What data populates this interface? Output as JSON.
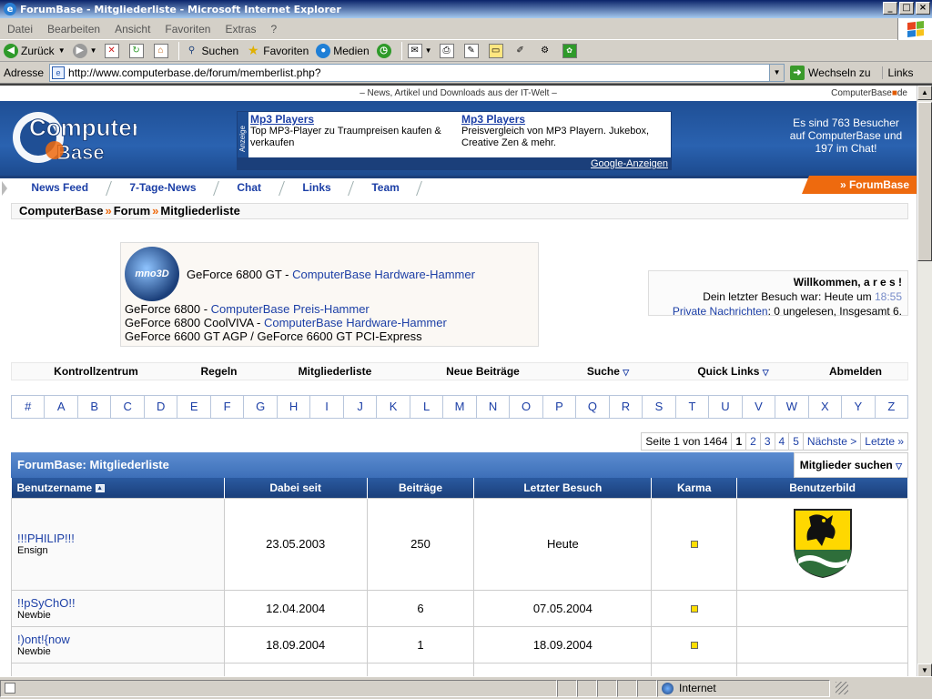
{
  "window": {
    "title": "ForumBase - Mitgliederliste - Microsoft Internet Explorer"
  },
  "menubar": [
    "Datei",
    "Bearbeiten",
    "Ansicht",
    "Favoriten",
    "Extras",
    "?"
  ],
  "toolbar": {
    "back": "Zurück",
    "search": "Suchen",
    "favorites": "Favoriten",
    "media": "Medien"
  },
  "addressbar": {
    "label": "Adresse",
    "url": "http://www.computerbase.de/forum/memberlist.php?",
    "go": "Wechseln zu",
    "links": "Links"
  },
  "site": {
    "tagline": "– News, Artikel und Downloads aus der IT-Welt –",
    "domain_left": "ComputerBase",
    "domain_right": "de",
    "logo_top": "Computer",
    "logo_bottom": "Base",
    "ad_label": "Anzeige",
    "ads": [
      {
        "title": "Mp3 Players",
        "text": "Top MP3-Player zu Traumpreisen kaufen & verkaufen"
      },
      {
        "title": "Mp3 Players",
        "text": "Preisvergleich von MP3 Playern. Jukebox, Creative Zen & mehr."
      }
    ],
    "ad_footer": "Google-Anzeigen",
    "visitors": "Es sind 763 Besucher auf ComputerBase und 197 im Chat!",
    "nav": [
      "News Feed",
      "7-Tage-News",
      "Chat",
      "Links",
      "Team"
    ],
    "section_tab": "» ForumBase"
  },
  "breadcrumb": [
    "ComputerBase",
    "Forum",
    "Mitgliederliste"
  ],
  "promo": {
    "logo": "mno3D",
    "line1_plain": "GeForce 6800 GT - ",
    "line1_link": "ComputerBase Hardware-Hammer",
    "line2_plain": "GeForce 6800 - ",
    "line2_link": "ComputerBase Preis-Hammer",
    "line3_plain": "GeForce 6800 CoolVIVA - ",
    "line3_link": "ComputerBase Hardware-Hammer",
    "line4_plain": "GeForce 6600 GT AGP / GeForce 6600 GT PCI-Express"
  },
  "welcome": {
    "greeting": "Willkommen, a r e s !",
    "last_visit_label": "Dein letzter Besuch war: Heute um ",
    "last_visit_time": "18:55",
    "pm_link": "Private Nachrichten",
    "pm_text": ": 0 ungelesen, Insgesamt 6."
  },
  "controls": [
    "Kontrollzentrum",
    "Regeln",
    "Mitgliederliste",
    "Neue Beiträge",
    "Suche",
    "Quick Links",
    "Abmelden"
  ],
  "alphabet": [
    "#",
    "A",
    "B",
    "C",
    "D",
    "E",
    "F",
    "G",
    "H",
    "I",
    "J",
    "K",
    "L",
    "M",
    "N",
    "O",
    "P",
    "Q",
    "R",
    "S",
    "T",
    "U",
    "V",
    "W",
    "X",
    "Y",
    "Z"
  ],
  "pager": {
    "label": "Seite 1 von 1464",
    "pages": [
      "1",
      "2",
      "3",
      "4",
      "5"
    ],
    "next": "Nächste >",
    "last": "Letzte »"
  },
  "memberlist": {
    "title": "ForumBase: Mitgliederliste",
    "search": "Mitglieder suchen",
    "columns": [
      "Benutzername",
      "Dabei seit",
      "Beiträge",
      "Letzter Besuch",
      "Karma",
      "Benutzerbild"
    ],
    "rows": [
      {
        "name": "!!!PHILIP!!!",
        "rank": "Ensign",
        "joined": "23.05.2003",
        "posts": "250",
        "last": "Heute"
      },
      {
        "name": "!!pSyChO!!",
        "rank": "Newbie",
        "joined": "12.04.2004",
        "posts": "6",
        "last": "07.05.2004"
      },
      {
        "name": "!)ont!{now",
        "rank": "Newbie",
        "joined": "18.09.2004",
        "posts": "1",
        "last": "18.09.2004"
      }
    ]
  },
  "status": {
    "zone": "Internet"
  },
  "colors": {
    "link": "#1c3fa6",
    "banner": "#1f4f95",
    "accent": "#ee6a0e",
    "header": "#1b3f7a"
  }
}
